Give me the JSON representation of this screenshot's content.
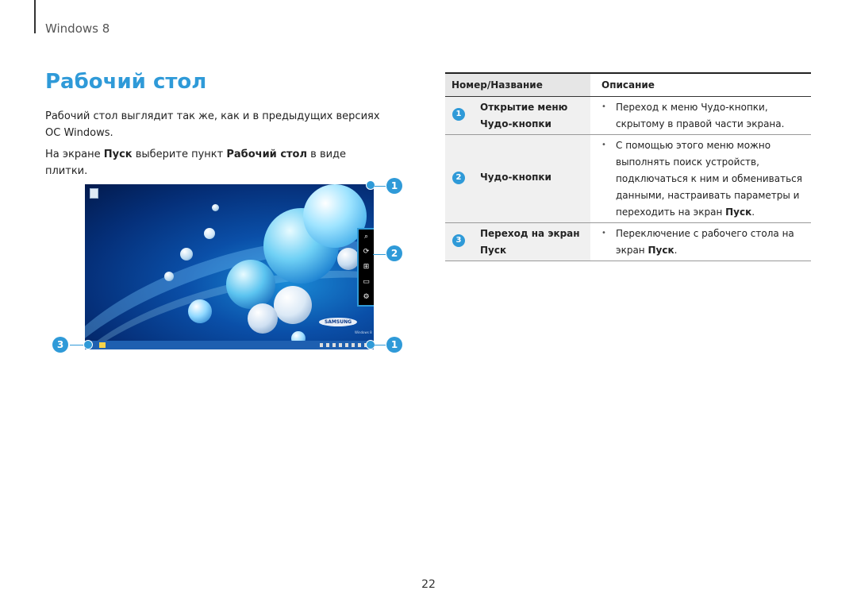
{
  "header": {
    "section": "Windows 8"
  },
  "page": {
    "title": "Рабочий стол",
    "para1": "Рабочий стол выглядит так же, как и в предыдущих версиях ОС Windows.",
    "para2_pre": "На экране ",
    "para2_b1": "Пуск",
    "para2_mid": " выберите пункт ",
    "para2_b2": "Рабочий стол",
    "para2_post": " в виде плитки.",
    "number": "22"
  },
  "screenshot": {
    "brand": "SAMSUNG",
    "windows_label": "Windows 8",
    "callouts": [
      "1",
      "2",
      "3",
      "1"
    ]
  },
  "table": {
    "header": {
      "col1": "Номер/Название",
      "col2": "Описание"
    },
    "rows": [
      {
        "num": "1",
        "name_line1": "Открытие меню",
        "name_line2": "Чудо-кнопки",
        "bullet": "•",
        "desc_line1": "Переход к меню Чудо-кнопки,",
        "desc_line2": "скрытому в правой части экрана."
      },
      {
        "num": "2",
        "name_line1": "Чудо-кнопки",
        "bullet": "•",
        "desc_line1": "С помощью этого меню можно",
        "desc_line2": "выполнять поиск устройств,",
        "desc_line3": "подключаться к ним и обмениваться",
        "desc_line4": "данными, настраивать параметры и",
        "desc_line5_pre": "переходить на экран ",
        "desc_line5_b": "Пуск",
        "desc_line5_post": "."
      },
      {
        "num": "3",
        "name_line1": "Переход на экран",
        "name_line2": "Пуск",
        "bullet": "•",
        "desc_line1": "Переключение с рабочего стола на",
        "desc_line2_pre": "экран ",
        "desc_line2_b": "Пуск",
        "desc_line2_post": "."
      }
    ]
  }
}
